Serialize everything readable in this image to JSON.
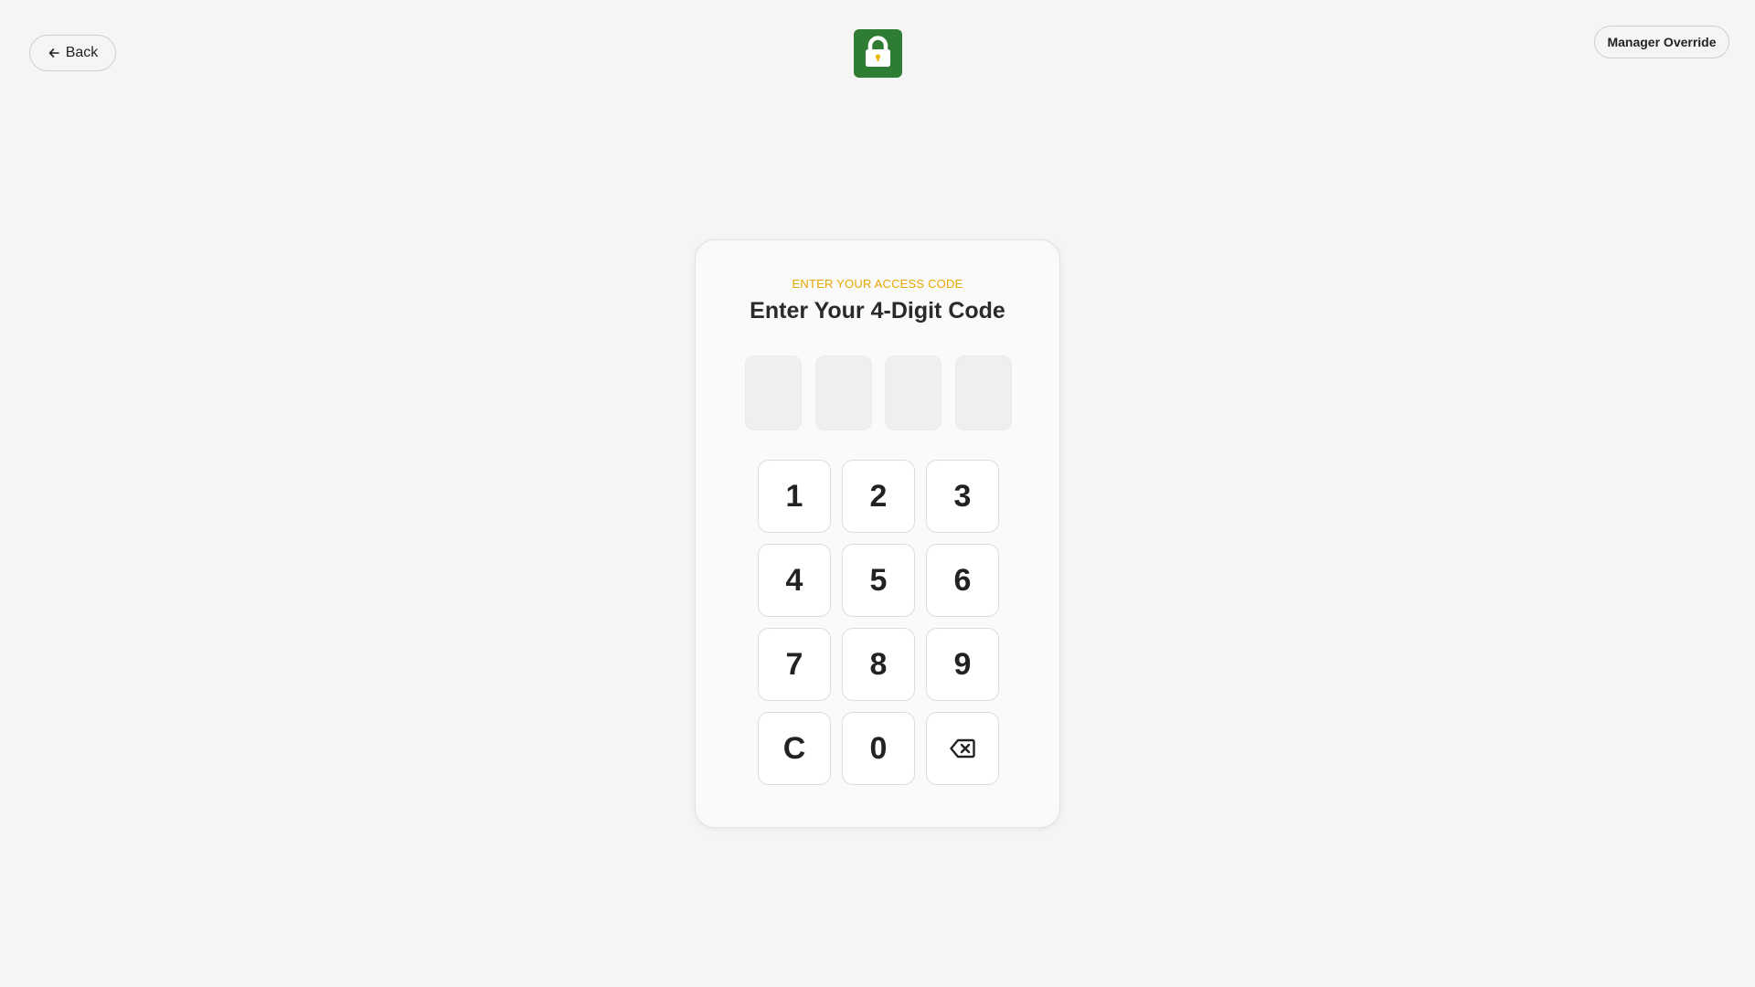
{
  "header": {
    "back_label": "Back",
    "back_icon": "arrow-left-icon",
    "logo_icon": "shopping-bag-lock-icon",
    "manager_override_label": "Manager Override"
  },
  "colors": {
    "background": "#f5f5f5",
    "logo_green": "#2e7d32",
    "accent_yellow": "#e6a700",
    "card": "#fafafa",
    "key": "#ffffff"
  },
  "card": {
    "eyebrow": "ENTER YOUR ACCESS CODE",
    "title": "Enter Your 4-Digit Code",
    "code_digits": [
      "",
      "",
      "",
      ""
    ]
  },
  "keypad": {
    "keys": [
      "1",
      "2",
      "3",
      "4",
      "5",
      "6",
      "7",
      "8",
      "9",
      "C",
      "0",
      ""
    ],
    "backspace_icon": "backspace-icon"
  }
}
